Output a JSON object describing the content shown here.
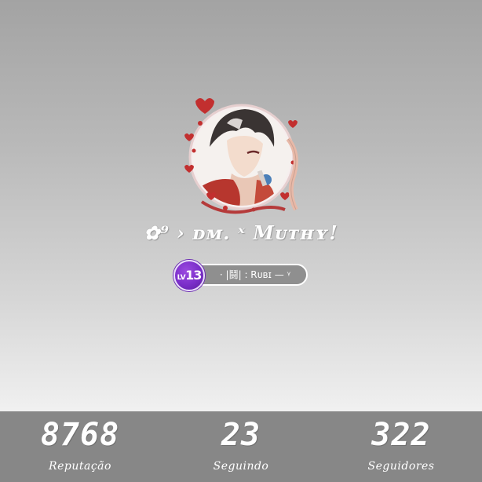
{
  "profile": {
    "avatar_icon": "avatar-with-heart-frame-icon",
    "username": "✿⁹ › ᴅᴍ. ˣ Mᴜᴛʜʏ!",
    "level_prefix": "LV",
    "level_number": "13",
    "title": "· |鬪| : Rᴜʙɪ — ᵞ"
  },
  "stats": [
    {
      "value": "8768",
      "label": "Reputação"
    },
    {
      "value": "23",
      "label": "Seguindo"
    },
    {
      "value": "322",
      "label": "Seguidores"
    }
  ],
  "colors": {
    "stats_bar": "#878787",
    "level_badge": "#7a2ec9",
    "title_pill": "#8f8f8f",
    "frame_hearts": "#c22f2f"
  }
}
